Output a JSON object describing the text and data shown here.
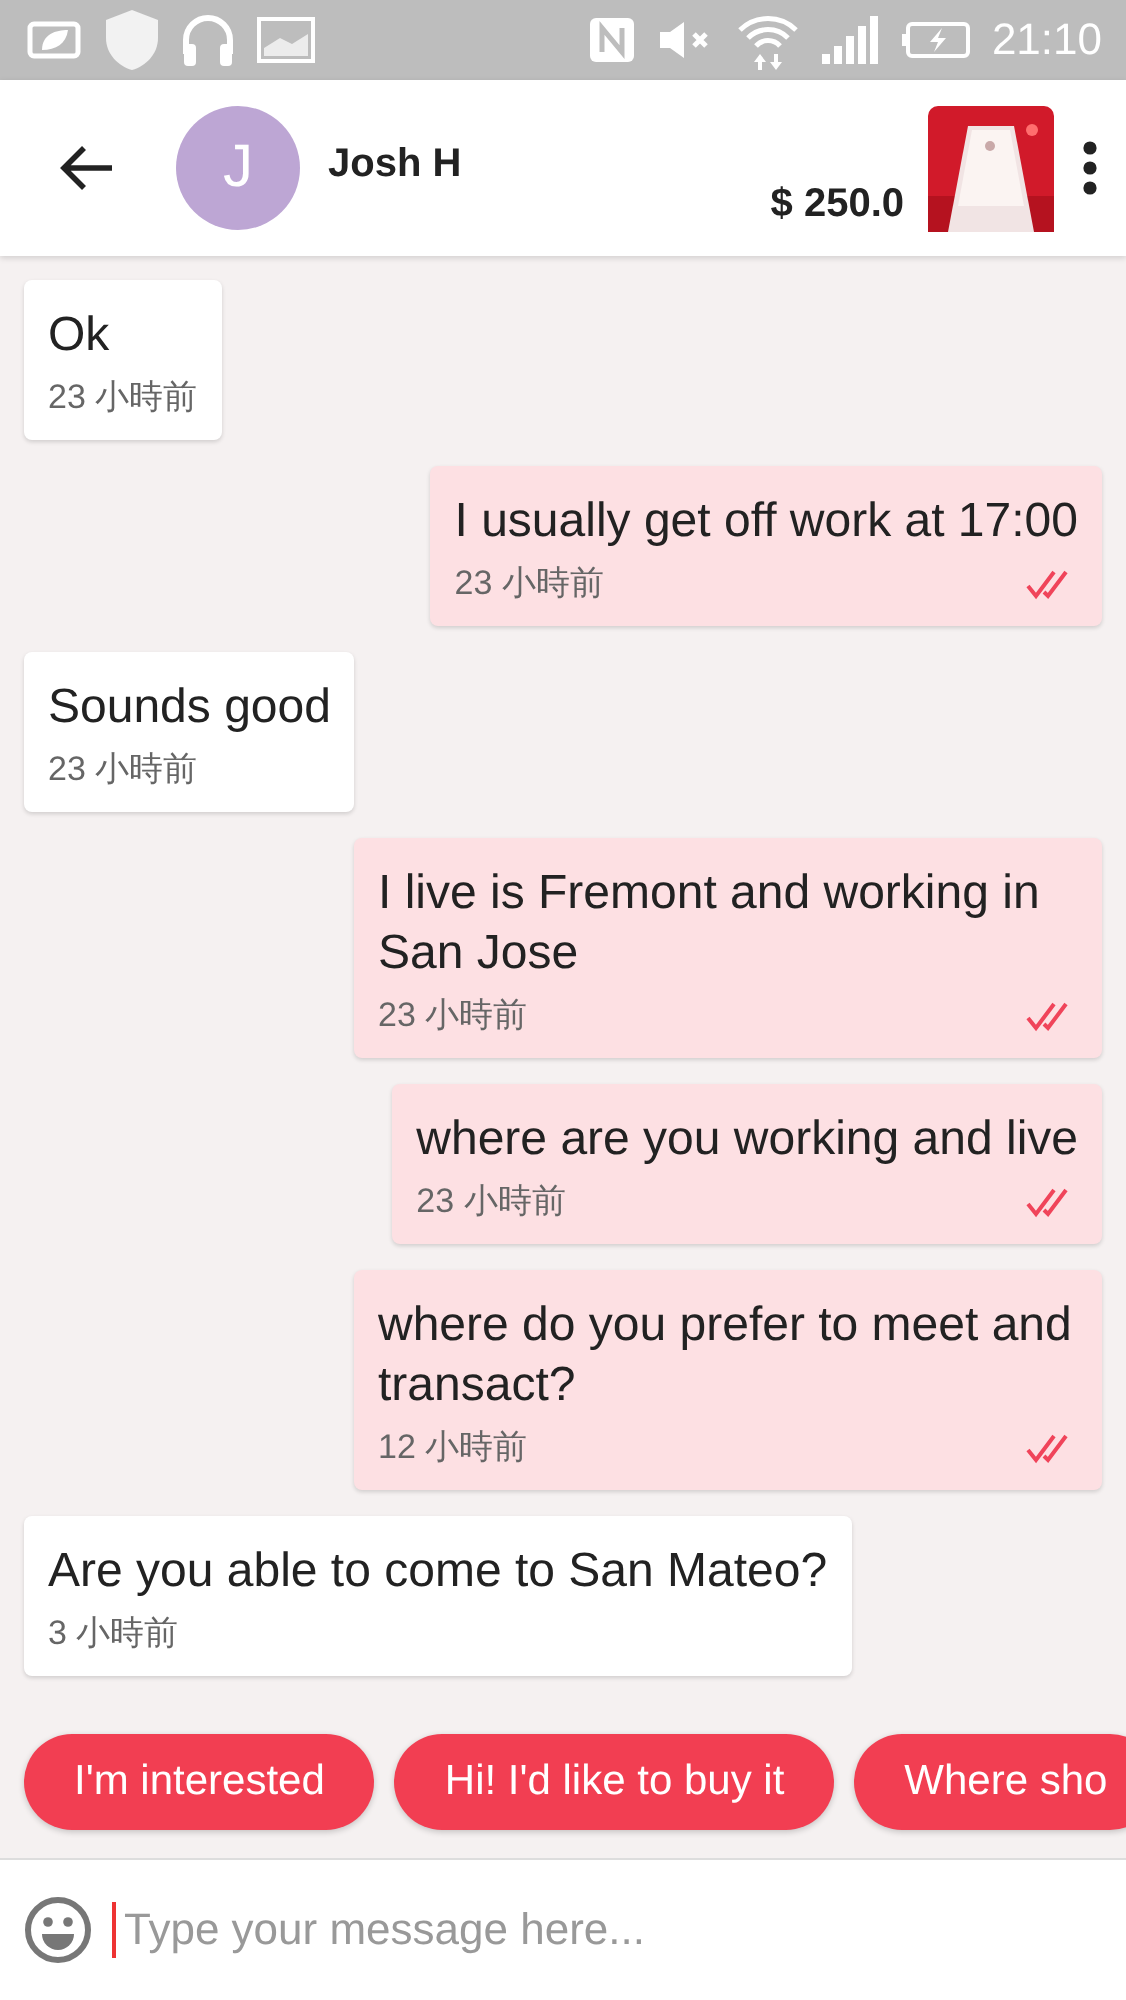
{
  "status_bar": {
    "time": "21:10"
  },
  "header": {
    "name": "Josh H",
    "avatar_initial": "J",
    "price": "$ 250.0"
  },
  "messages": [
    {
      "kind": "incoming",
      "text": "Ok",
      "time": "23 小時前",
      "read": false
    },
    {
      "kind": "outgoing",
      "text": "I usually get off work at 17:00",
      "time": "23 小時前",
      "read": true
    },
    {
      "kind": "incoming",
      "text": "Sounds good",
      "time": "23 小時前",
      "read": false
    },
    {
      "kind": "outgoing",
      "text": "I live is Fremont and working in San Jose",
      "time": "23 小時前",
      "read": true
    },
    {
      "kind": "outgoing",
      "text": "where are you working and live",
      "time": "23 小時前",
      "read": true
    },
    {
      "kind": "outgoing",
      "text": "where do you prefer to meet and transact?",
      "time": "12 小時前",
      "read": true
    },
    {
      "kind": "incoming",
      "text": "Are you able to come to San Mateo?",
      "time": "3 小時前",
      "read": false
    }
  ],
  "quick_replies": [
    "I'm interested",
    "Hi! I'd like to buy it",
    "Where sho"
  ],
  "composer": {
    "placeholder": "Type your message here..."
  }
}
